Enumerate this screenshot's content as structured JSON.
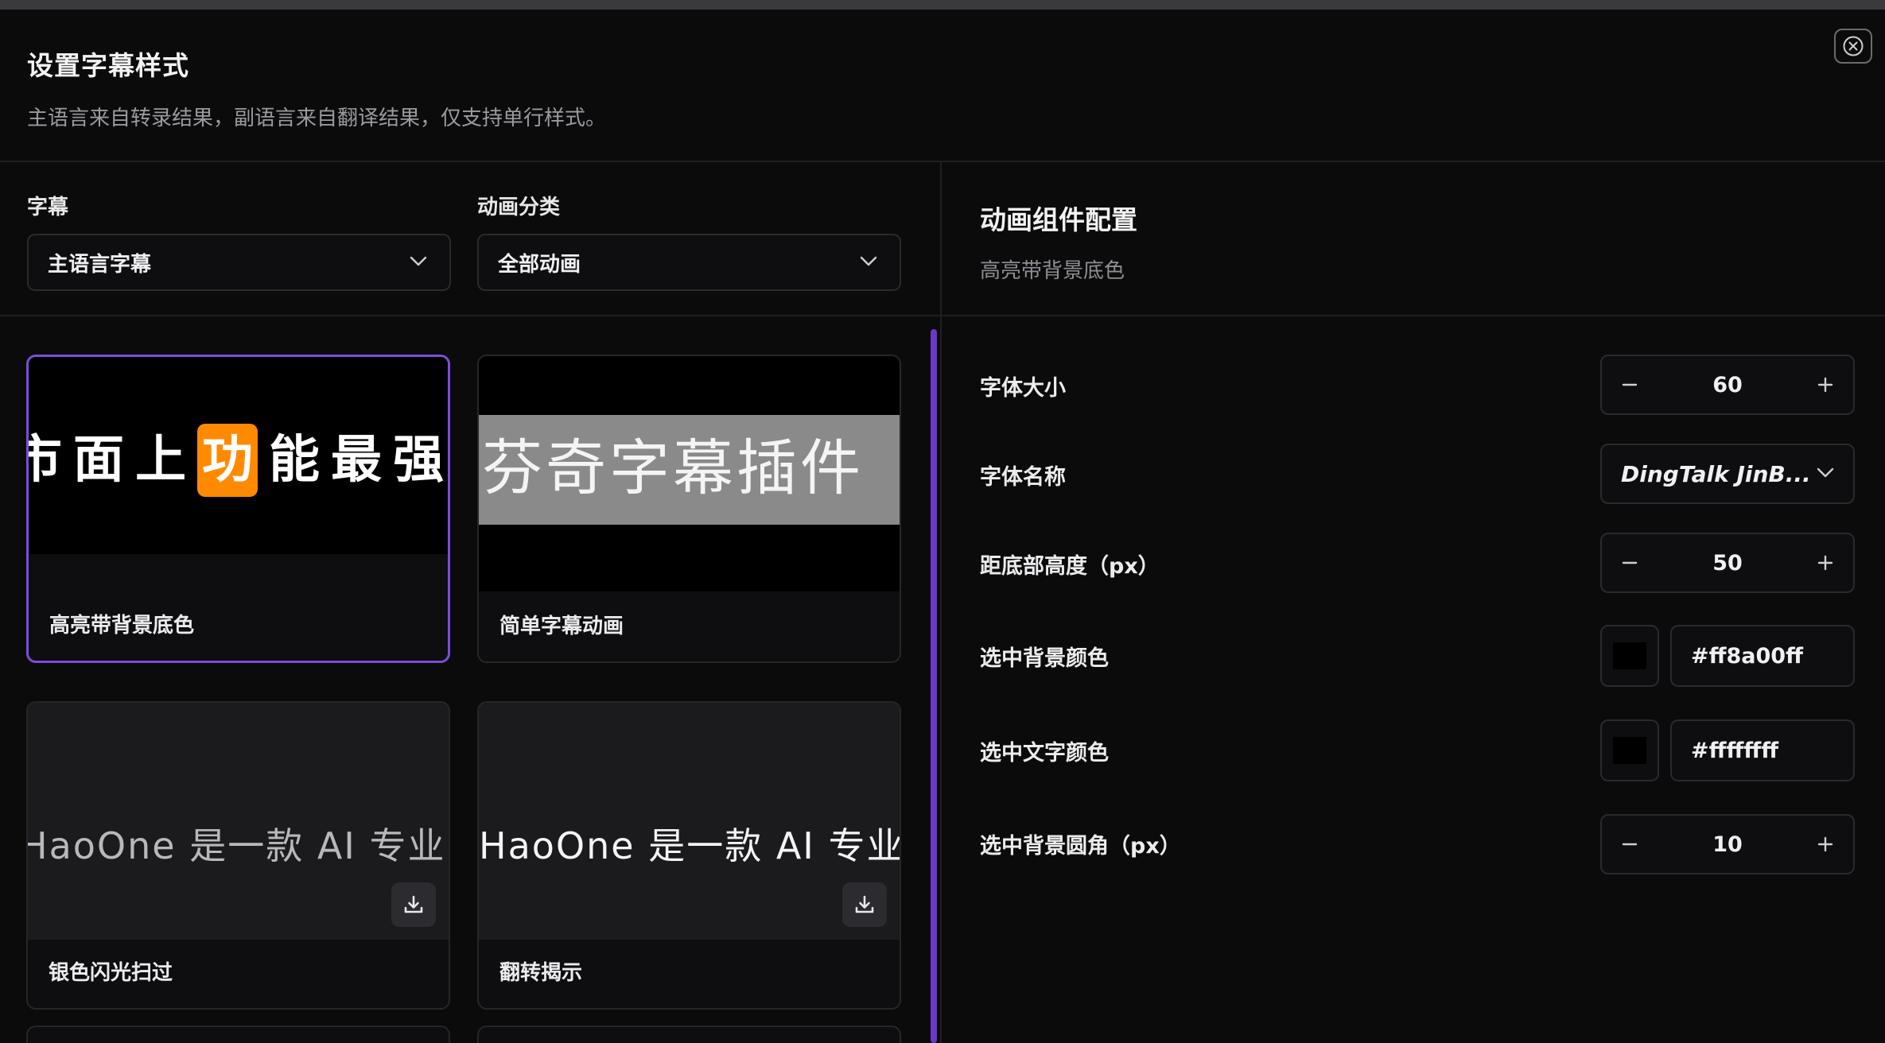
{
  "dialog": {
    "title": "设置字幕样式",
    "subtitle": "主语言来自转录结果，副语言来自翻译结果，仅支持单行样式。"
  },
  "filters": {
    "subtitle_label": "字幕",
    "subtitle_value": "主语言字幕",
    "category_label": "动画分类",
    "category_value": "全部动画"
  },
  "cards": [
    {
      "label": "高亮带背景底色",
      "preview_chars": [
        "市",
        "面",
        "上",
        "功",
        "能",
        "最",
        "强"
      ],
      "highlight_char": "功",
      "selected": true
    },
    {
      "label": "简单字幕动画",
      "preview_text": "芬奇字幕插件"
    },
    {
      "label": "银色闪光扫过",
      "preview_text": "HaoOne 是一款 AI 专业"
    },
    {
      "label": "翻转揭示",
      "preview_text": "HaoOne 是一款 AI 专业"
    }
  ],
  "panel": {
    "title": "动画组件配置",
    "subtitle": "高亮带背景底色",
    "font_size": {
      "label": "字体大小",
      "value": "60"
    },
    "font_name": {
      "label": "字体名称",
      "value": "DingTalk JinB..."
    },
    "bottom_height": {
      "label": "距底部高度（px）",
      "value": "50"
    },
    "selected_bg_color": {
      "label": "选中背景颜色",
      "value": "#ff8a00ff"
    },
    "selected_text_color": {
      "label": "选中文字颜色",
      "value": "#ffffffff"
    },
    "selected_bg_radius": {
      "label": "选中背景圆角（px）",
      "value": "10"
    }
  },
  "colors": {
    "accent": "#7c4ddb",
    "highlight": "#ff8a00"
  }
}
